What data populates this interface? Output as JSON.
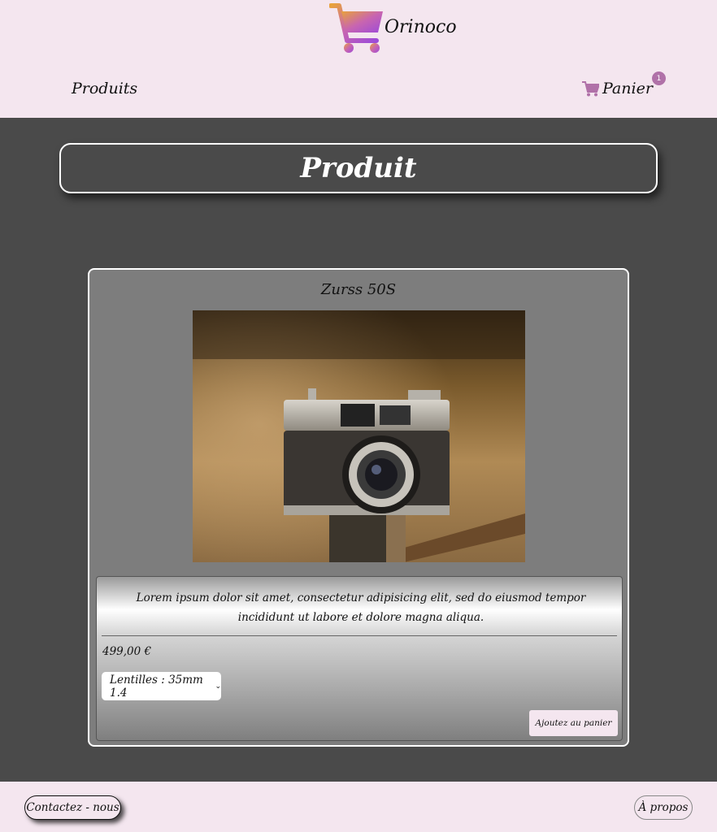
{
  "header": {
    "brand": "Orinoco",
    "nav_products": "Produits",
    "nav_cart": "Panier",
    "cart_count": "1",
    "icons": {
      "logo": "shopping-cart-icon",
      "cart": "shopping-cart-icon"
    },
    "colors": {
      "header_bg": "#f4e6ef",
      "cart_gradient_start": "#e8a23c",
      "cart_gradient_end": "#9d4bd8",
      "badge": "#b071a8"
    }
  },
  "page": {
    "title": "Produit"
  },
  "product": {
    "name": "Zurss 50S",
    "description": "Lorem ipsum dolor sit amet, consectetur adipisicing elit, sed do eiusmod tempor incididunt ut labore et dolore magna aliqua.",
    "price": "499,00 €",
    "lens_option": "Lentilles : 35mm 1.4",
    "add_to_cart_label": "Ajoutez au panier"
  },
  "footer": {
    "contact_label": "Contactez - nous",
    "about_label": "À propos"
  }
}
